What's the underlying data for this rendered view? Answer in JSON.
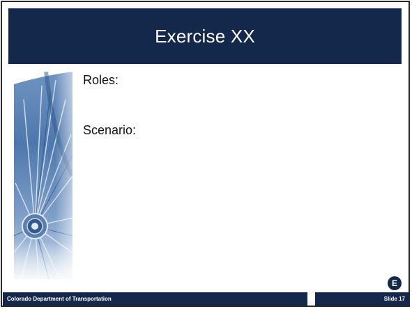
{
  "slide": {
    "title": "Exercise XX",
    "roles_label": "Roles:",
    "scenario_label": "Scenario:",
    "badge_letter": "E",
    "footer_left": "Colorado Department of Transportation",
    "footer_right": "Slide 17",
    "side_image_icon": "bicycle-wheel-spokes-image",
    "colors": {
      "navy": "#14284b",
      "image_blue": "#3c6ea6",
      "text": "#111111"
    }
  }
}
